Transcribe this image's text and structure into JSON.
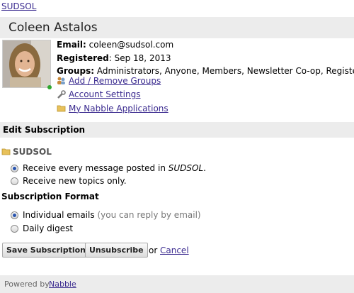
{
  "forum_link": "SUDSOL",
  "profile": {
    "name": "Coleen Astalos",
    "email_label": "Email:",
    "email": "coleen@sudsol.com",
    "registered_label": "Registered",
    "registered": ": Sep 18, 2013",
    "groups_label": "Groups:",
    "groups": "Administrators, Anyone, Members, Newsletter Co-op, Registered"
  },
  "links": {
    "groups": "Add / Remove Groups",
    "settings": "Account Settings",
    "apps": "My Nabble Applications"
  },
  "edit_subscription": {
    "header": "Edit Subscription",
    "forum": "SUDSOL",
    "option_all_prefix": "Receive every message posted in ",
    "option_all_forum": "SUDSOL",
    "option_all_suffix": ".",
    "option_topics": "Receive new topics only.",
    "format_title": "Subscription Format",
    "format_individual": "Individual emails",
    "format_individual_note": "(you can reply by email)",
    "format_digest": "Daily digest"
  },
  "buttons": {
    "save": "Save Subscription",
    "unsubscribe": "Unsubscribe",
    "or": "or",
    "cancel": "Cancel"
  },
  "footer": {
    "powered_by": "Powered by",
    "link": "Nabble"
  }
}
